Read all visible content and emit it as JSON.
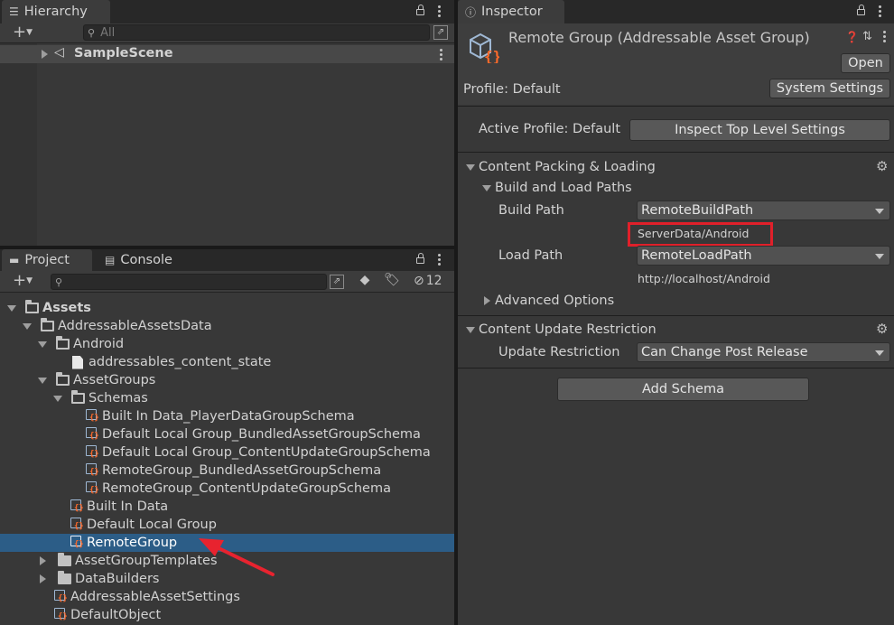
{
  "hierarchy": {
    "tab_label": "Hierarchy",
    "search_placeholder": "All",
    "scene_name": "SampleScene"
  },
  "project": {
    "tab_label": "Project",
    "console_tab_label": "Console",
    "hidden_count": "12",
    "tree": {
      "assets": "Assets",
      "addressable_assets_data": "AddressableAssetsData",
      "android": "Android",
      "content_state": "addressables_content_state",
      "asset_groups": "AssetGroups",
      "schemas": "Schemas",
      "schema_1": "Built In Data_PlayerDataGroupSchema",
      "schema_2": "Default Local Group_BundledAssetGroupSchema",
      "schema_3": "Default Local Group_ContentUpdateGroupSchema",
      "schema_4": "RemoteGroup_BundledAssetGroupSchema",
      "schema_5": "RemoteGroup_ContentUpdateGroupSchema",
      "group_builtin": "Built In Data",
      "group_default_local": "Default Local Group",
      "group_remote": "RemoteGroup",
      "asset_group_templates": "AssetGroupTemplates",
      "data_builders": "DataBuilders",
      "settings": "AddressableAssetSettings",
      "default_object": "DefaultObject"
    }
  },
  "inspector": {
    "tab_label": "Inspector",
    "title": "Remote Group (Addressable Asset Group)",
    "open_button": "Open",
    "profile_label": "Profile: Default",
    "system_settings_button": "System Settings",
    "active_profile_label": "Active Profile: Default",
    "inspect_button": "Inspect Top Level Settings",
    "content_packing_header": "Content Packing & Loading",
    "build_load_paths_header": "Build and Load Paths",
    "build_path_label": "Build Path",
    "build_path_value": "RemoteBuildPath",
    "build_path_resolved": "ServerData/Android",
    "load_path_label": "Load Path",
    "load_path_value": "RemoteLoadPath",
    "load_path_resolved": "http://localhost/Android",
    "advanced_options": "Advanced Options",
    "content_update_header": "Content Update Restriction",
    "update_restriction_label": "Update Restriction",
    "update_restriction_value": "Can Change Post Release",
    "add_schema_button": "Add Schema"
  },
  "colors": {
    "selection": "#2c5d87",
    "highlight_box": "#e0202a",
    "arrow": "#e8232f",
    "panel_bg": "#383838"
  }
}
